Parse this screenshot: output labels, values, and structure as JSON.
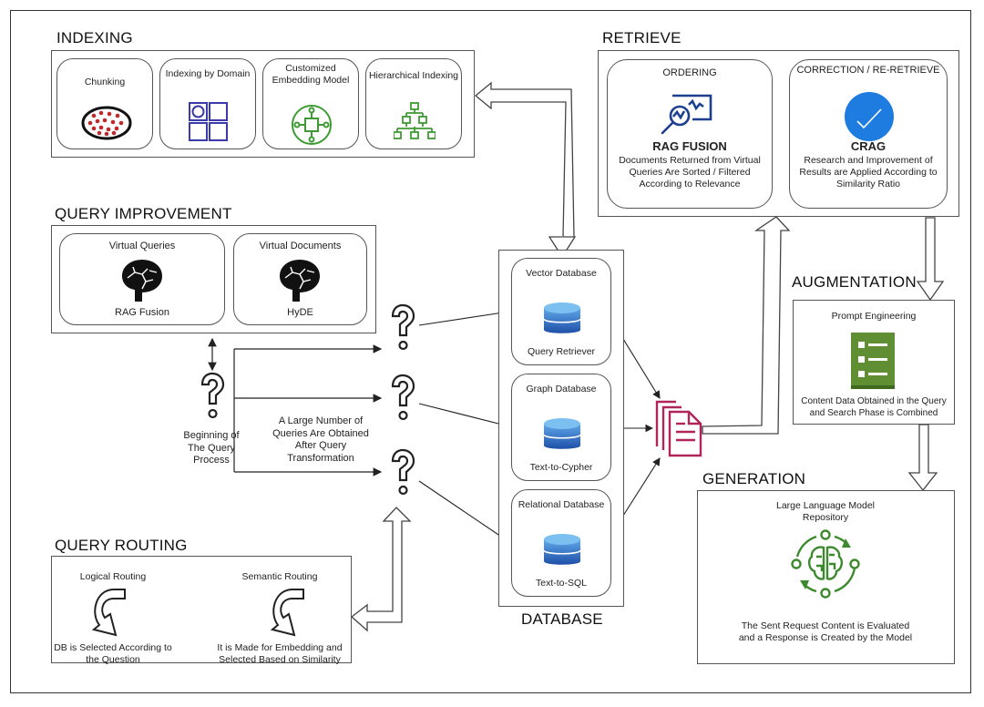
{
  "indexing": {
    "title": "INDEXING",
    "items": [
      {
        "label": "Chunking",
        "icon": "chunking-dots-icon"
      },
      {
        "label": "Indexing by Domain",
        "icon": "domain-grid-icon"
      },
      {
        "label": "Customized Embedding Model",
        "icon": "embedding-model-icon"
      },
      {
        "label": "Hierarchical Indexing",
        "icon": "hierarchy-tree-icon"
      }
    ]
  },
  "retrieve": {
    "title": "RETRIEVE",
    "items": [
      {
        "header": "ORDERING",
        "name": "RAG FUSION",
        "description": "Documents Returned from Virtual Queries Are Sorted / Filtered According to Relevance",
        "icon": "magnifier-chart-icon"
      },
      {
        "header": "CORRECTION / RE-RETRIEVE",
        "name": "CRAG",
        "description": "Research and Improvement of Results are Applied According to Similarity Ratio",
        "icon": "checkmark-circle-icon"
      }
    ]
  },
  "query_improvement": {
    "title": "QUERY IMPROVEMENT",
    "items": [
      {
        "header": "Virtual Queries",
        "label": "RAG Fusion",
        "icon": "brain-icon"
      },
      {
        "header": "Virtual Documents",
        "label": "HyDE",
        "icon": "brain-icon"
      }
    ]
  },
  "query_flow": {
    "start_label": "Beginning of The Query Process",
    "transform_label": "A Large Number of Queries Are Obtained After Query Transformation"
  },
  "database": {
    "title": "DATABASE",
    "items": [
      {
        "header": "Vector Database",
        "label": "Query Retriever",
        "icon": "database-icon"
      },
      {
        "header": "Graph Database",
        "label": "Text-to-Cypher",
        "icon": "database-icon"
      },
      {
        "header": "Relational Database",
        "label": "Text-to-SQL",
        "icon": "database-icon"
      }
    ]
  },
  "augmentation": {
    "title": "AUGMENTATION",
    "header": "Prompt Engineering",
    "description": "Content Data Obtained in the Query and Search Phase is Combined",
    "icon": "checklist-icon"
  },
  "generation": {
    "title": "GENERATION",
    "header": "Large Language Model Repository",
    "description": "The Sent Request Content is Evaluated and a Response is Created by the Model",
    "icon": "ai-brain-cycle-icon"
  },
  "query_routing": {
    "title": "QUERY ROUTING",
    "items": [
      {
        "header": "Logical Routing",
        "description": "DB is Selected According to the Question",
        "icon": "curved-arrow-icon"
      },
      {
        "header": "Semantic Routing",
        "description": "It is Made for Embedding and Selected Based on Similarity",
        "icon": "curved-arrow-icon"
      }
    ]
  },
  "colors": {
    "indexing_blue": "#3a3aa8",
    "indexing_green": "#3f9a35",
    "chunk_red": "#c0282a",
    "retrieve_blue": "#1d3f8f",
    "crag_blue": "#1e7be0",
    "db_blue": "#2f6fc4",
    "docs_magenta": "#b0245a",
    "checklist_green": "#5f8f32",
    "llm_green": "#3d8a2e"
  }
}
